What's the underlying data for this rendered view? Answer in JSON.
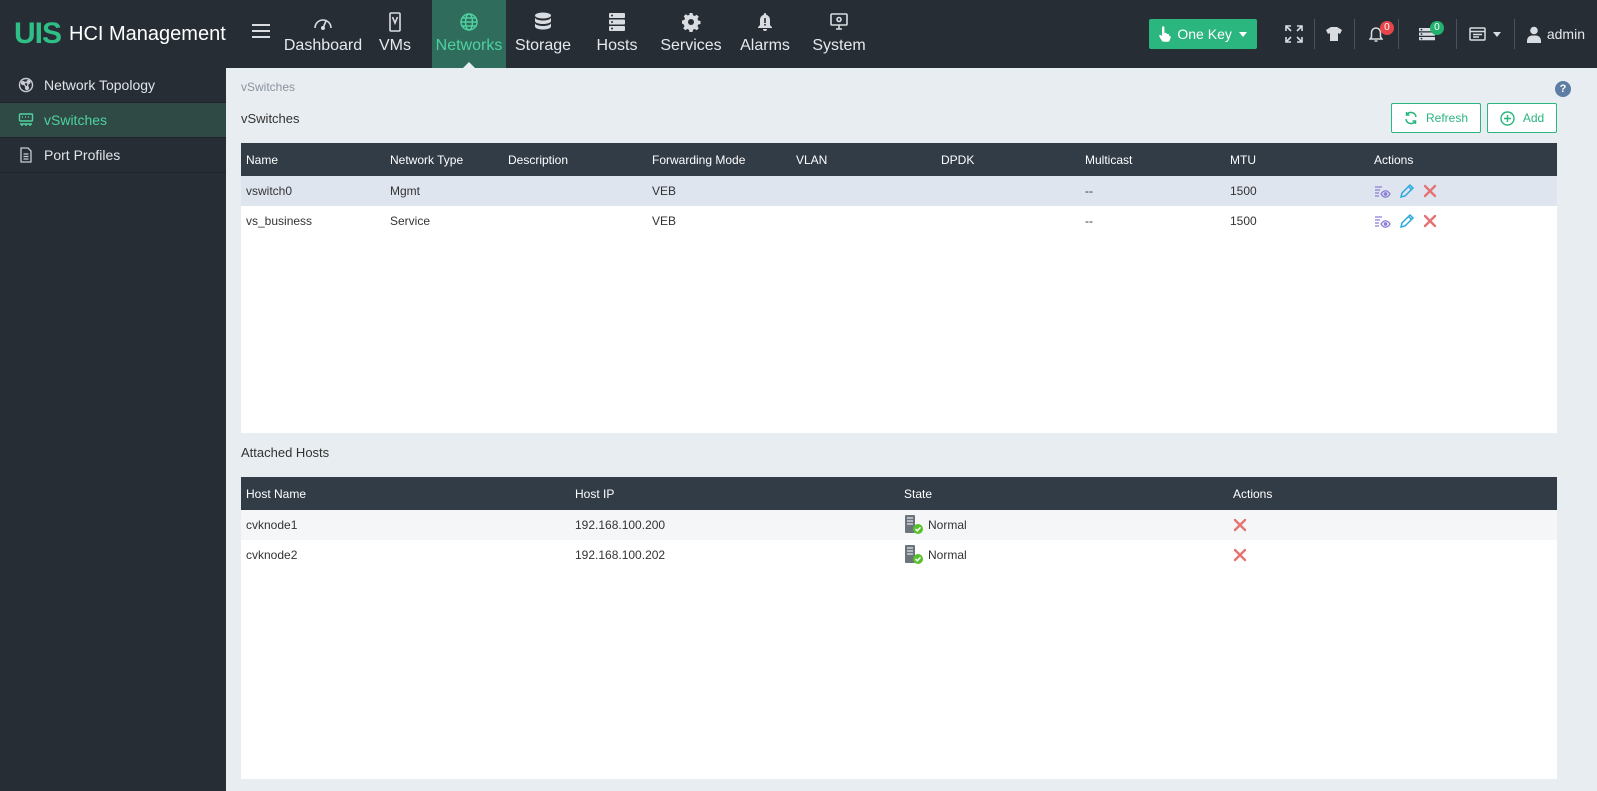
{
  "brand": {
    "mark": "UIS",
    "name": "HCI Management"
  },
  "nav": [
    {
      "label": "Dashboard",
      "icon": "gauge-icon"
    },
    {
      "label": "VMs",
      "icon": "vm-icon"
    },
    {
      "label": "Networks",
      "icon": "globe-icon"
    },
    {
      "label": "Storage",
      "icon": "database-icon"
    },
    {
      "label": "Hosts",
      "icon": "server-icon"
    },
    {
      "label": "Services",
      "icon": "gear-icon"
    },
    {
      "label": "Alarms",
      "icon": "bell-icon"
    },
    {
      "label": "System",
      "icon": "monitor-icon"
    }
  ],
  "topbar": {
    "one_key": "One Key",
    "alarm_count": "0",
    "task_count": "0",
    "user": "admin"
  },
  "sidebar": [
    {
      "label": "Network Topology",
      "icon": "topology-icon"
    },
    {
      "label": "vSwitches",
      "icon": "switch-icon"
    },
    {
      "label": "Port Profiles",
      "icon": "document-icon"
    }
  ],
  "main": {
    "breadcrumb": "vSwitches",
    "title": "vSwitches",
    "refresh": "Refresh",
    "add": "Add",
    "help": "?"
  },
  "vswitch_table": {
    "headers": [
      "Name",
      "Network Type",
      "Description",
      "Forwarding Mode",
      "VLAN",
      "DPDK",
      "Multicast",
      "MTU",
      "Actions"
    ],
    "rows": [
      [
        "vswitch0",
        "Mgmt",
        "",
        "VEB",
        "",
        "",
        "--",
        "1500"
      ],
      [
        "vs_business",
        "Service",
        "",
        "VEB",
        "",
        "",
        "--",
        "1500"
      ]
    ]
  },
  "hosts_section": {
    "title": "Attached Hosts",
    "headers": [
      "Host Name",
      "Host IP",
      "State",
      "Actions"
    ],
    "rows": [
      [
        "cvknode1",
        "192.168.100.200",
        "Normal"
      ],
      [
        "cvknode2",
        "192.168.100.202",
        "Normal"
      ]
    ]
  },
  "colors": {
    "accent": "#2bb57f",
    "topbar": "#262d35",
    "table_header": "#323c47",
    "delete": "#e57373",
    "edit": "#29a8e0"
  }
}
